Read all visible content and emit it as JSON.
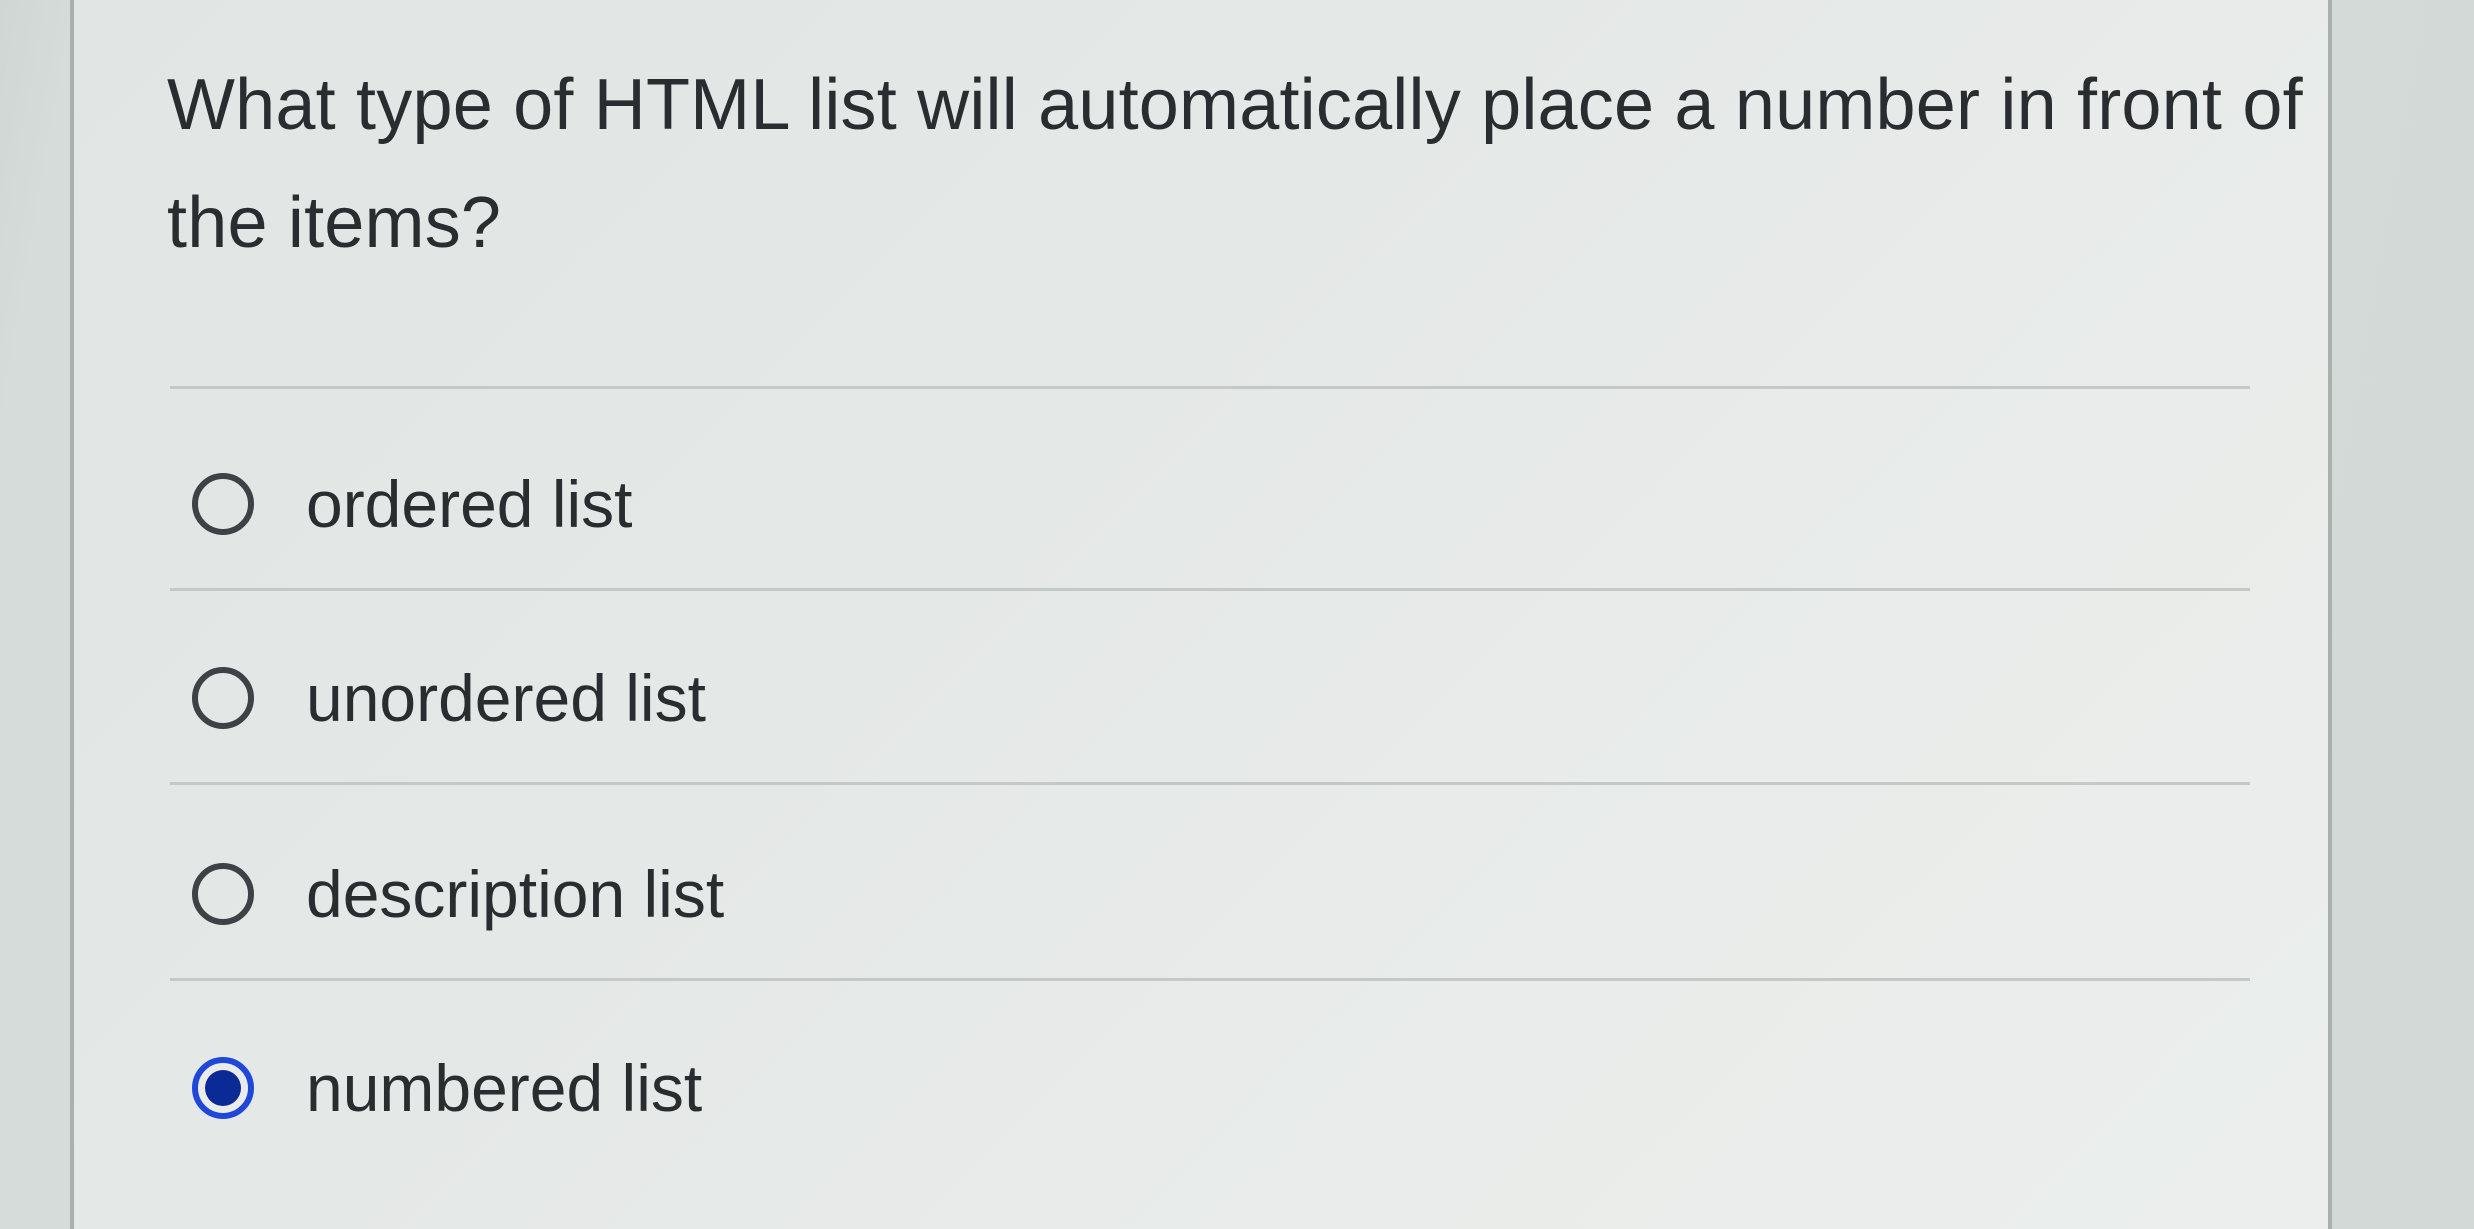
{
  "question": {
    "text": "What type of HTML list will automatically place a number in front of the items?"
  },
  "options": [
    {
      "label": "ordered list",
      "selected": false
    },
    {
      "label": "unordered list",
      "selected": false
    },
    {
      "label": "description list",
      "selected": false
    },
    {
      "label": "numbered list",
      "selected": true
    }
  ],
  "colors": {
    "selected_radio": "#1f48d8",
    "text": "#2a2d30"
  }
}
